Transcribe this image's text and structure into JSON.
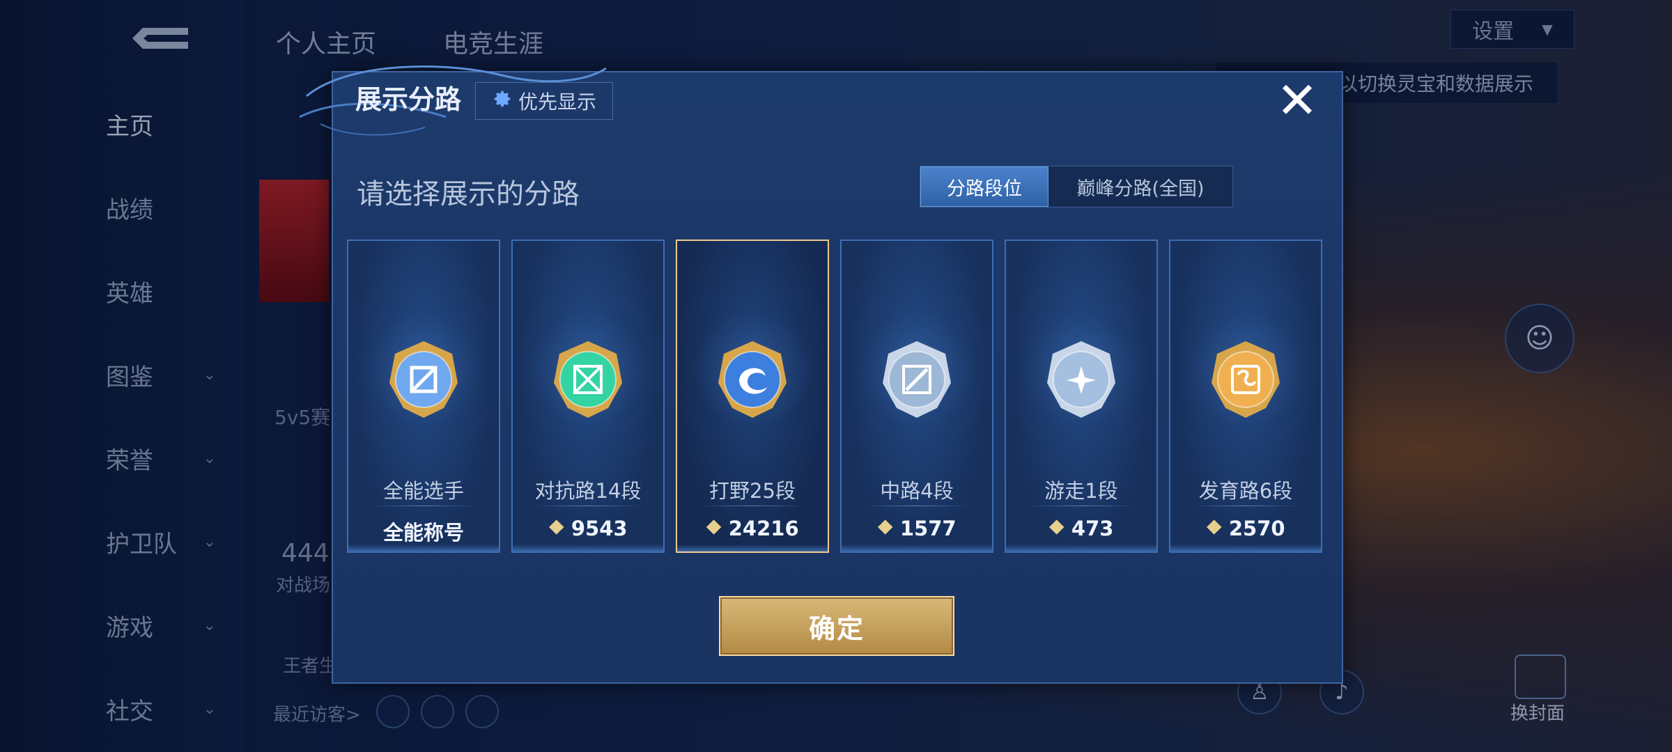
{
  "sidebar": {
    "items": [
      {
        "label": "主页",
        "has_chevron": false
      },
      {
        "label": "战绩",
        "has_chevron": false
      },
      {
        "label": "英雄",
        "has_chevron": false
      },
      {
        "label": "图鉴",
        "has_chevron": true
      },
      {
        "label": "荣誉",
        "has_chevron": true
      },
      {
        "label": "护卫队",
        "has_chevron": true
      },
      {
        "label": "游戏",
        "has_chevron": true
      },
      {
        "label": "社交",
        "has_chevron": true
      }
    ]
  },
  "background": {
    "tabs": [
      "个人主页",
      "电竞生涯"
    ],
    "settings_label": "设置",
    "tip_text": "以切换灵宝和数据展示",
    "rank_text": "5v5赛",
    "count_text": "444",
    "count_sub": "对战场",
    "kings_text": "王者生",
    "recent_visitors": "最近访客>",
    "change_cover": "换封面"
  },
  "modal": {
    "title": "展示分路",
    "priority_label": "优先显示",
    "prompt": "请选择展示的分路",
    "toggle": {
      "active": "分路段位",
      "inactive": "巅峰分路(全国)"
    },
    "confirm_label": "确定",
    "cards": [
      {
        "name": "全能选手",
        "score": "全能称号",
        "show_points_icon": false,
        "emblem": "all-round-emblem",
        "accent": "#6fa8ee",
        "selected": false
      },
      {
        "name": "对抗路14段",
        "score": "9543",
        "show_points_icon": true,
        "emblem": "clash-lane-emblem",
        "accent": "#34d3a2",
        "selected": false
      },
      {
        "name": "打野25段",
        "score": "24216",
        "show_points_icon": true,
        "emblem": "jungle-emblem",
        "accent": "#3d7fdf",
        "selected": true
      },
      {
        "name": "中路4段",
        "score": "1577",
        "show_points_icon": true,
        "emblem": "mid-lane-emblem",
        "accent": "#9db7d6",
        "selected": false
      },
      {
        "name": "游走1段",
        "score": "473",
        "show_points_icon": true,
        "emblem": "roam-emblem",
        "accent": "#a5bfe0",
        "selected": false
      },
      {
        "name": "发育路6段",
        "score": "2570",
        "show_points_icon": true,
        "emblem": "farm-lane-emblem",
        "accent": "#f0b052",
        "selected": false
      }
    ]
  }
}
